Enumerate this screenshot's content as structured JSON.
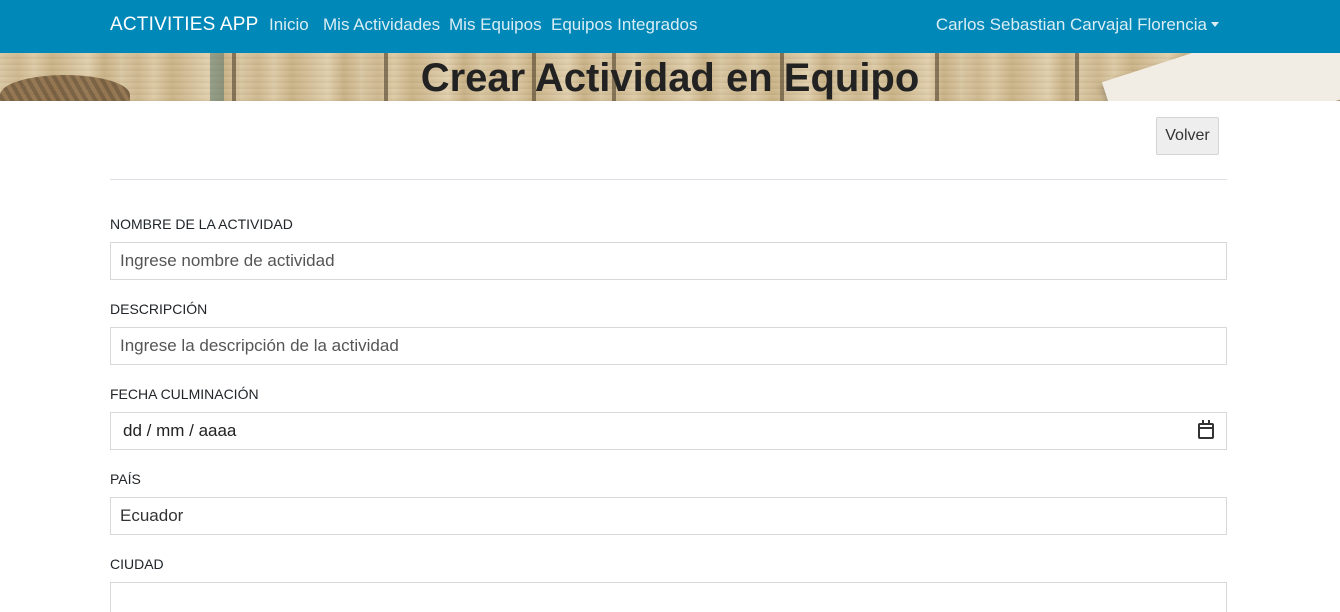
{
  "navbar": {
    "brand": "ACTIVITIES APP",
    "links": [
      "Inicio",
      "Mis Actividades",
      "Mis Equipos",
      "Equipos Integrados"
    ],
    "user": "Carlos Sebastian Carvajal Florencia",
    "bg_color": "#0088b8"
  },
  "banner": {
    "title": "Crear Actividad en Equipo"
  },
  "actions": {
    "volver": "Volver"
  },
  "form": {
    "nombre": {
      "label": "NOMBRE DE LA ACTIVIDAD",
      "placeholder": "Ingrese nombre de actividad",
      "value": ""
    },
    "descripcion": {
      "label": "DESCRIPCIÓN",
      "placeholder": "Ingrese la descripción de la actividad",
      "value": ""
    },
    "fecha": {
      "label": "FECHA CULMINACIÓN",
      "placeholder": "dd / mm / aaaa",
      "icon": "calendar-icon"
    },
    "pais": {
      "label": "PAÍS",
      "value": "Ecuador"
    },
    "ciudad": {
      "label": "CIUDAD",
      "value": ""
    }
  }
}
